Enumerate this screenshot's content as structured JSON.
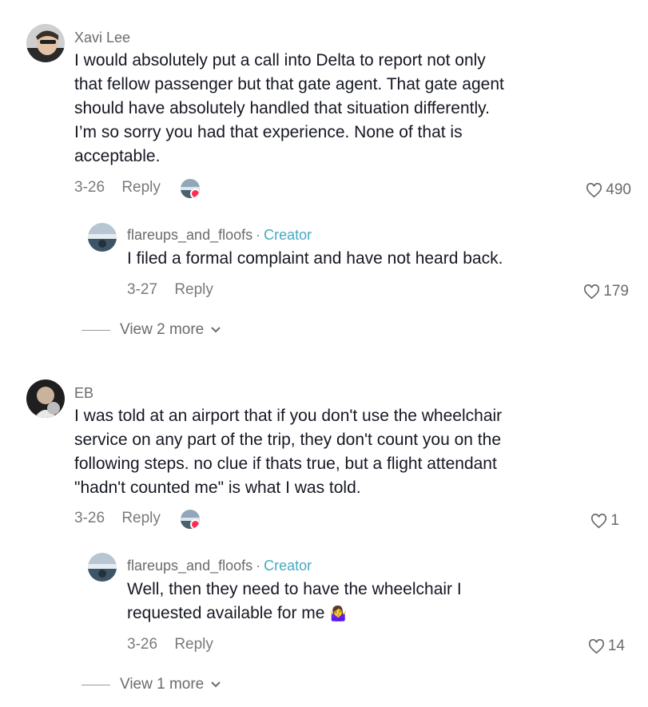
{
  "comments": [
    {
      "username": "Xavi Lee",
      "text_lines": [
        "I would absolutely put a call into Delta to report not only",
        "that fellow passenger but that gate agent. That gate agent",
        "should have absolutely handled that situation differently.",
        "I’m so sorry you had that experience. None of that is",
        "acceptable."
      ],
      "date": "3-26",
      "reply_label": "Reply",
      "likes": "490",
      "reply": {
        "username": "flareups_and_floofs",
        "separator": "·",
        "badge": "Creator",
        "text_lines": [
          "I filed a formal complaint and have not heard back."
        ],
        "date": "3-27",
        "reply_label": "Reply",
        "likes": "179"
      },
      "view_more": "View 2 more"
    },
    {
      "username": "EB",
      "text_lines": [
        "I was told at an airport that if you don't use the wheelchair",
        "service on any part of the trip, they don't count you on the",
        "following steps. no clue if thats true, but a flight attendant",
        "\"hadn't counted me\" is what I was told."
      ],
      "date": "3-26",
      "reply_label": "Reply",
      "likes": "1",
      "reply": {
        "username": "flareups_and_floofs",
        "separator": "·",
        "badge": "Creator",
        "text_lines": [
          "Well, then they need to have the wheelchair I",
          "requested available for me"
        ],
        "emoji": "🤷‍♀️",
        "date": "3-26",
        "reply_label": "Reply",
        "likes": "14"
      },
      "view_more": "View 1 more"
    }
  ],
  "icons": {
    "heart": "heart-outline-icon",
    "chevron": "chevron-down-icon",
    "creator_liked": "creator-liked-avatar-icon"
  },
  "colors": {
    "creator_badge": "#47a8c2",
    "liked_badge": "#fe2c55",
    "meta_text": "#7a7a7a"
  }
}
